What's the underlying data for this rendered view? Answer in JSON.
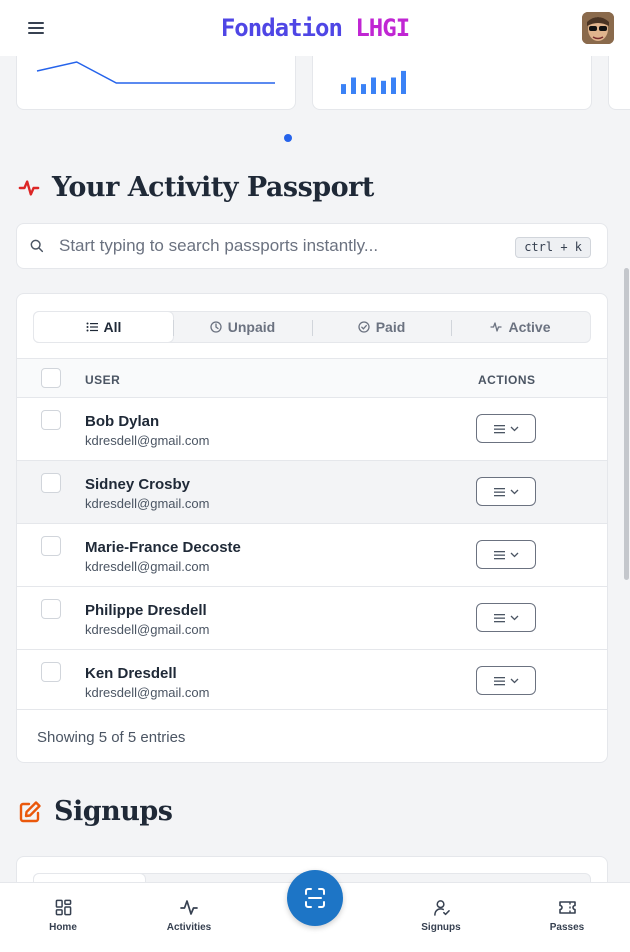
{
  "header": {
    "brand_part1": "Fondation",
    "brand_part2": "LHGI"
  },
  "carousel": {
    "line_values": [
      30,
      45,
      10,
      10,
      10,
      10,
      10
    ],
    "bar_values": [
      3,
      5,
      3,
      5,
      4,
      5,
      7
    ]
  },
  "passport": {
    "title": "Your Activity Passport",
    "search_placeholder": "Start typing to search passports instantly...",
    "shortcut": "ctrl + k",
    "tabs": [
      {
        "label": "All",
        "icon": "list-icon"
      },
      {
        "label": "Unpaid",
        "icon": "clock-icon"
      },
      {
        "label": "Paid",
        "icon": "check-circle-icon"
      },
      {
        "label": "Active",
        "icon": "activity-icon"
      }
    ],
    "columns": {
      "user": "USER",
      "actions": "ACTIONS"
    },
    "rows": [
      {
        "name": "Bob Dylan",
        "email": "kdresdell@gmail.com"
      },
      {
        "name": "Sidney Crosby",
        "email": "kdresdell@gmail.com"
      },
      {
        "name": "Marie-France Decoste",
        "email": "kdresdell@gmail.com"
      },
      {
        "name": "Philippe Dresdell",
        "email": "kdresdell@gmail.com"
      },
      {
        "name": "Ken Dresdell",
        "email": "kdresdell@gmail.com"
      }
    ],
    "footer": "Showing 5 of 5 entries"
  },
  "signups": {
    "title": "Signups"
  },
  "bottom_nav": {
    "home": "Home",
    "activities": "Activities",
    "signups": "Signups",
    "passes": "Passes"
  },
  "colors": {
    "accent": "#1d75c6",
    "brand_primary": "#4f46e5",
    "brand_secondary": "#c026d3",
    "passport_icon": "#dc2626",
    "signups_icon": "#ea580c"
  }
}
